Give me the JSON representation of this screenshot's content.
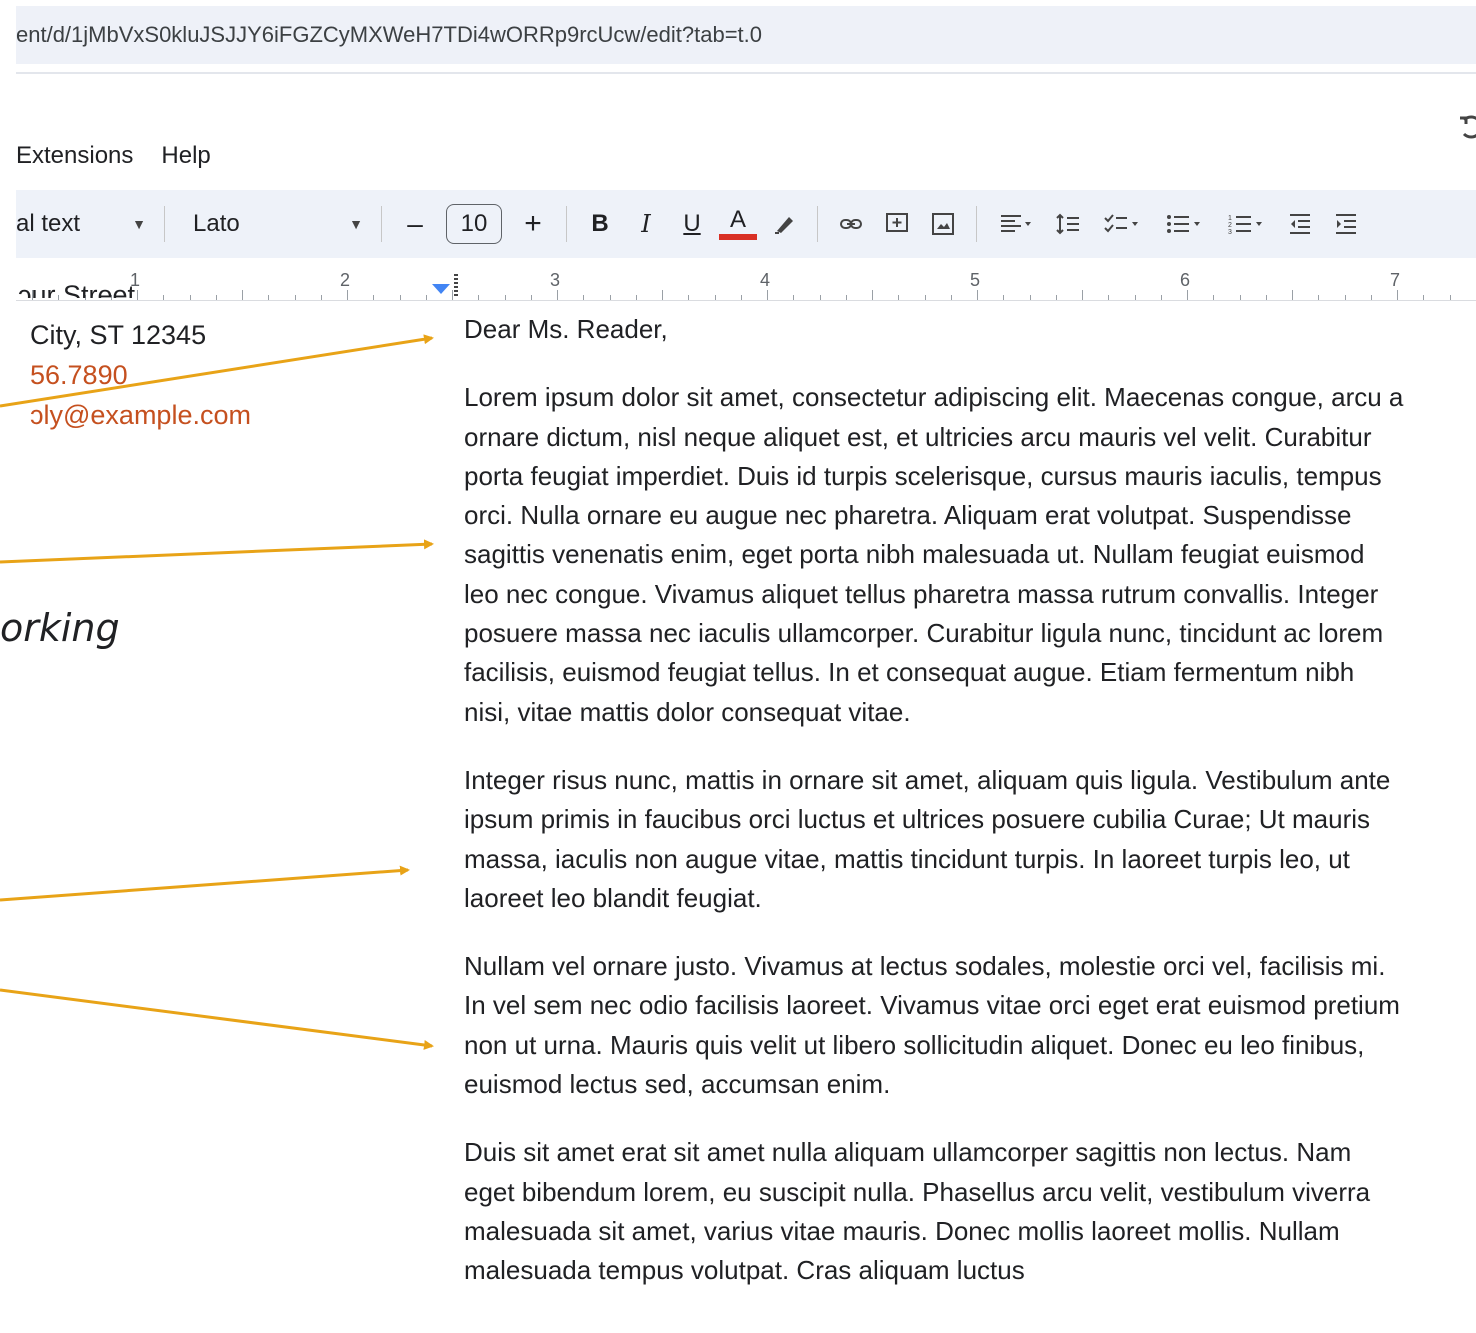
{
  "browser": {
    "url": "ent/d/1jMbVxS0kluJSJJY6iFGZCyMXWeH7TDi4wORRp9rcUcw/edit?tab=t.0"
  },
  "menubar": {
    "items": [
      "Extensions",
      "Help"
    ]
  },
  "toolbar": {
    "paragraph_style": "al text",
    "font": "Lato",
    "font_size": "10",
    "minus": "–",
    "plus": "+",
    "bold": "B",
    "italic": "I",
    "underline": "U",
    "text_color": "A",
    "text_color_hex": "#d93025"
  },
  "ruler": {
    "numbers": [
      "1",
      "2",
      "3",
      "4",
      "5",
      "6",
      "7"
    ]
  },
  "sidebar": {
    "address_lines": [
      "ɔur Street",
      "City, ST 12345",
      "56.7890",
      "ɔly@example.com"
    ],
    "italic_fragment": "orking",
    "accent_hex": "#c5501f"
  },
  "document": {
    "salutation": "Dear Ms. Reader,",
    "paragraphs": [
      "Lorem ipsum dolor sit amet, consectetur adipiscing elit. Maecenas congue, arcu a ornare dictum, nisl neque aliquet est, et ultricies arcu mauris vel velit. Curabitur porta feugiat imperdiet. Duis id turpis scelerisque, cursus mauris iaculis, tempus orci. Nulla ornare eu augue nec pharetra. Aliquam erat volutpat. Suspendisse sagittis venenatis enim, eget porta nibh malesuada ut. Nullam feugiat euismod leo nec congue. Vivamus aliquet tellus pharetra massa rutrum convallis. Integer posuere massa nec iaculis ullamcorper. Curabitur ligula nunc, tincidunt ac lorem facilisis, euismod feugiat tellus. In et consequat augue. Etiam fermentum nibh nisi, vitae mattis dolor consequat vitae.",
      "Integer risus nunc, mattis in ornare sit amet, aliquam quis ligula. Vestibulum ante ipsum primis in faucibus orci luctus et ultrices posuere cubilia Curae; Ut mauris massa, iaculis non augue vitae, mattis tincidunt turpis. In laoreet turpis leo, ut laoreet leo blandit feugiat.",
      "Nullam vel ornare justo. Vivamus at lectus sodales, molestie orci vel, facilisis mi. In vel sem nec odio facilisis laoreet. Vivamus vitae orci eget erat euismod pretium non ut urna. Mauris quis velit ut libero sollicitudin aliquet. Donec eu leo finibus, euismod lectus sed, accumsan enim.",
      "Duis sit amet erat sit amet nulla aliquam ullamcorper sagittis non lectus. Nam eget bibendum lorem, eu suscipit nulla. Phasellus arcu velit, vestibulum viverra malesuada sit amet, varius vitae mauris. Donec mollis laoreet mollis. Nullam malesuada tempus volutpat. Cras aliquam luctus"
    ]
  },
  "colors": {
    "arrow": "#e8a317",
    "toolbar_bg": "#eef2f9"
  }
}
